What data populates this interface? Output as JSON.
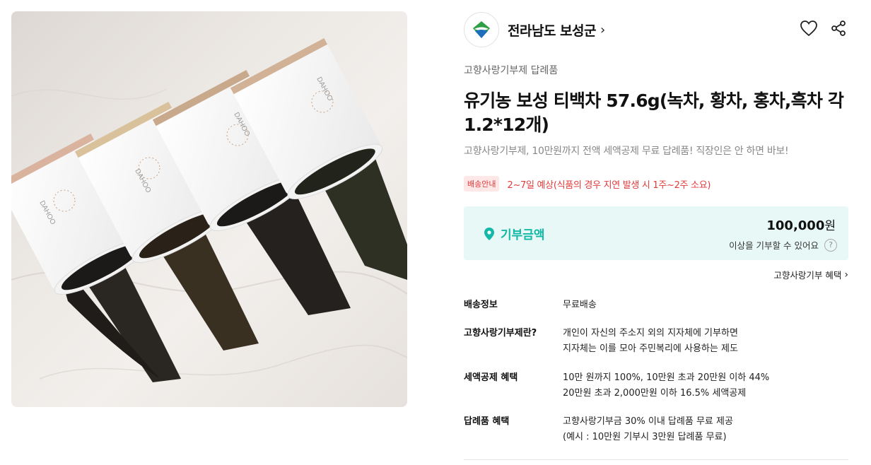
{
  "seller": {
    "name": "전라남도 보성군",
    "chevron": "›"
  },
  "actions": {
    "wish_icon": "heart-icon",
    "share_icon": "share-icon"
  },
  "product": {
    "category": "고향사랑기부제 답례품",
    "title": "유기농 보성 티백차 57.6g(녹차, 황차, 홍차,흑차 각 1.2*12개)",
    "subtitle": "고향사랑기부제, 10만원까지 전액 세액공제 무료 답례품! 직장인은 안 하면 바보!",
    "image_labels": [
      "DAHOO",
      "DAHOO",
      "DAHOO",
      "DAHOO"
    ]
  },
  "delivery": {
    "badge": "배송안내",
    "text": "2~7일 예상(식품의 경우 지연 발생 시 1주~2주 소요)"
  },
  "donation": {
    "label": "기부금액",
    "amount": "100,000",
    "currency": "원",
    "note": "이상을 기부할 수 있어요",
    "help": "?"
  },
  "benefit_link": {
    "label": "고향사랑기부 혜택",
    "chevron": "›"
  },
  "info": [
    {
      "key": "배송정보",
      "lines": [
        "무료배송"
      ]
    },
    {
      "key": "고향사랑기부제란?",
      "lines": [
        "개인이 자신의 주소지 외의 지자체에 기부하면",
        "지자체는 이를 모아 주민복리에 사용하는 제도"
      ]
    },
    {
      "key": "세액공제 혜택",
      "lines": [
        "10만 원까지 100%, 10만원 초과 20만원 이하 44%",
        "20만원 초과 2,000만원 이하 16.5% 세액공제"
      ]
    },
    {
      "key": "답례품 혜택",
      "lines": [
        "고향사랑기부금 30% 이내 답례품 무료 제공",
        "(예시 : 10만원 기부시 3만원 답례품 무료)"
      ]
    }
  ],
  "colors": {
    "accent": "#14b8a6",
    "warning": "#e23b3b",
    "donation_bg": "#e8f8f6"
  }
}
